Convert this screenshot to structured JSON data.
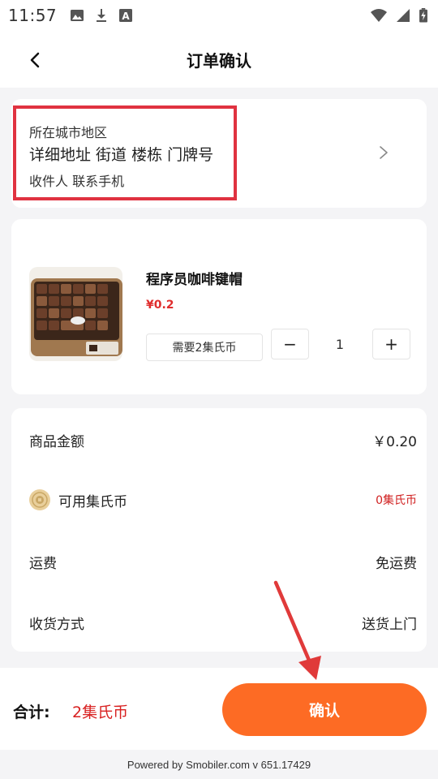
{
  "status_bar": {
    "time": "11:57",
    "icons_left": [
      "image-icon",
      "download-icon",
      "font-a-icon"
    ],
    "icons_right": [
      "wifi-icon",
      "signal-icon",
      "battery-charging-icon"
    ]
  },
  "nav": {
    "title": "订单确认",
    "back_icon": "chevron-left-icon"
  },
  "address": {
    "city_region": "所在城市地区",
    "detail": "详细地址 街道 楼栋 门牌号",
    "contact": "收件人 联系手机",
    "highlight_color": "#e03240"
  },
  "product": {
    "name": "程序员咖啡键帽",
    "price": "¥0.2",
    "need_coins": "需要2集氏币",
    "quantity": "1",
    "minus_label": "−",
    "plus_label": "+"
  },
  "summary": {
    "amount_label": "商品金额",
    "amount_value": "￥0.20",
    "coins_label": "可用集氏币",
    "coins_value": "0集氏币",
    "shipping_label": "运费",
    "shipping_value": "免运费",
    "delivery_label": "收货方式",
    "delivery_value": "送货上门"
  },
  "bottom": {
    "total_label": "合计:",
    "total_value": "2集氏币",
    "confirm_label": "确认",
    "accent_color": "#fd6b24"
  },
  "footer": {
    "text": "Powered by Smobiler.com v 651.17429"
  }
}
